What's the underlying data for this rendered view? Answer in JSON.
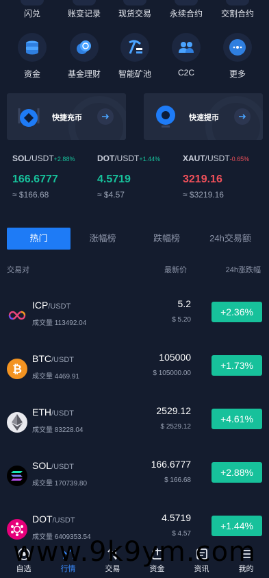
{
  "top_row": [
    {
      "label": "闪兑"
    },
    {
      "label": "账变记录"
    },
    {
      "label": "现货交易"
    },
    {
      "label": "永续合约"
    },
    {
      "label": "交割合约"
    }
  ],
  "icon_row": [
    {
      "label": "资金",
      "icon": "coin-stack-icon"
    },
    {
      "label": "基金理财",
      "icon": "coins-icon"
    },
    {
      "label": "智能矿池",
      "icon": "pickaxe-icon"
    },
    {
      "label": "C2C",
      "icon": "users-icon"
    },
    {
      "label": "更多",
      "icon": "more-icon"
    }
  ],
  "quick": {
    "deposit_label": "快捷充币",
    "withdraw_label": "快速提币"
  },
  "tickers": [
    {
      "base": "SOL",
      "quote": "/USDT",
      "change": "+2.88%",
      "price": "166.6777",
      "fiat": "≈ $166.68",
      "dir": "up"
    },
    {
      "base": "DOT",
      "quote": "/USDT",
      "change": "+1.44%",
      "price": "4.5719",
      "fiat": "≈ $4.57",
      "dir": "up"
    },
    {
      "base": "XAUT",
      "quote": "/USDT",
      "change": "-0.65%",
      "price": "3219.16",
      "fiat": "≈ $3219.16",
      "dir": "down"
    }
  ],
  "tabs": [
    "热门",
    "涨幅榜",
    "跌幅榜",
    "24h交易额"
  ],
  "columns": {
    "pair": "交易对",
    "last": "最新价",
    "change": "24h涨跌幅"
  },
  "markets": [
    {
      "base": "ICP",
      "quote": "/USDT",
      "volume": "成交量 113492.04",
      "last": "5.2",
      "fiat": "$ 5.20",
      "change": "+2.36%",
      "coin_icon": "icp-icon"
    },
    {
      "base": "BTC",
      "quote": "/USDT",
      "volume": "成交量 4469.91",
      "last": "105000",
      "fiat": "$ 105000.00",
      "change": "+1.73%",
      "coin_icon": "btc-icon"
    },
    {
      "base": "ETH",
      "quote": "/USDT",
      "volume": "成交量 83228.04",
      "last": "2529.12",
      "fiat": "$ 2529.12",
      "change": "+4.61%",
      "coin_icon": "eth-icon"
    },
    {
      "base": "SOL",
      "quote": "/USDT",
      "volume": "成交量 170739.80",
      "last": "166.6777",
      "fiat": "$ 166.68",
      "change": "+2.88%",
      "coin_icon": "sol-icon"
    },
    {
      "base": "DOT",
      "quote": "/USDT",
      "volume": "成交量 6409353.54",
      "last": "4.5719",
      "fiat": "$ 4.57",
      "change": "+1.44%",
      "coin_icon": "dot-icon"
    }
  ],
  "watermark": "www.9k9ym.com",
  "bottom_nav": [
    {
      "label": "自选",
      "icon": "star-icon"
    },
    {
      "label": "行情",
      "icon": "chart-icon"
    },
    {
      "label": "交易",
      "icon": "trade-icon"
    },
    {
      "label": "资金",
      "icon": "wallet-icon"
    },
    {
      "label": "资讯",
      "icon": "news-icon"
    },
    {
      "label": "我的",
      "icon": "profile-icon"
    }
  ],
  "colors": {
    "accent": "#1e7bf6",
    "up": "#17c19b",
    "down": "#f0505a",
    "background": "#141c2e"
  }
}
